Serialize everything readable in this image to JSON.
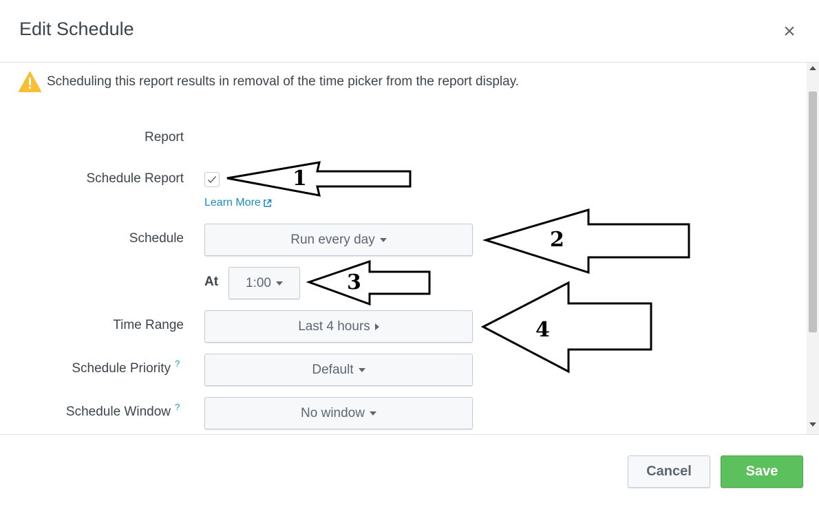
{
  "dialog": {
    "title": "Edit Schedule",
    "close_icon": "close-icon",
    "close_glyph": "×"
  },
  "warning": {
    "icon": "warning-triangle-icon",
    "color": "#f8be34",
    "text": "Scheduling this report results in removal of the time picker from the report display."
  },
  "form": {
    "report_label": "Report",
    "report_value": "",
    "schedule_report_label": "Schedule Report",
    "schedule_report_checked": true,
    "learn_more": "Learn More",
    "schedule_label": "Schedule",
    "schedule_value": "Run every day",
    "at_label": "At",
    "at_value": "1:00",
    "time_range_label": "Time Range",
    "time_range_value": "Last 4 hours",
    "priority_label": "Schedule Priority",
    "priority_help": "?",
    "priority_value": "Default",
    "window_label": "Schedule Window",
    "window_help": "?",
    "window_value": "No window"
  },
  "footer": {
    "cancel_label": "Cancel",
    "save_label": "Save",
    "save_color": "#5cc05c"
  },
  "annotations": {
    "arrow1": "1",
    "arrow2": "2",
    "arrow3": "3",
    "arrow4": "4"
  }
}
